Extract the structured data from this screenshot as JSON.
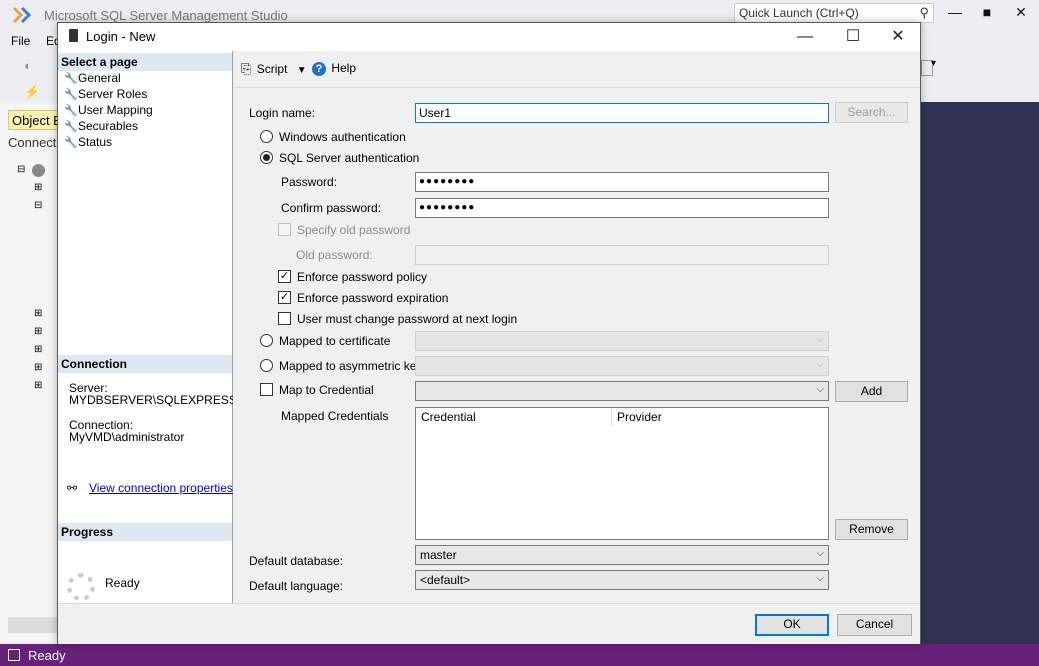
{
  "app": {
    "title": "Microsoft SQL Server Management Studio",
    "quick_launch_placeholder": "Quick Launch (Ctrl+Q)",
    "menu": [
      "File",
      "Ed"
    ],
    "object_explorer_tab": "Object E",
    "object_explorer_connect": "Connect",
    "status": "Ready"
  },
  "dialog": {
    "title": "Login - New",
    "toolbar": {
      "script": "Script",
      "help": "Help"
    },
    "left": {
      "select_page_header": "Select a page",
      "pages": [
        "General",
        "Server Roles",
        "User Mapping",
        "Securables",
        "Status"
      ],
      "connection_header": "Connection",
      "server_label": "Server:",
      "server_value": "MYDBSERVER\\SQLEXPRESS",
      "connection_label": "Connection:",
      "connection_value": "MyVMD\\administrator",
      "view_connection_link": "View connection properties",
      "progress_header": "Progress",
      "progress_status": "Ready"
    },
    "form": {
      "login_name_label": "Login name:",
      "login_name_value": "User1",
      "search_button": "Search...",
      "windows_auth": "Windows authentication",
      "sql_auth": "SQL Server authentication",
      "auth_selected": "sql",
      "password_label": "Password:",
      "password_value": "●●●●●●●●",
      "confirm_password_label": "Confirm password:",
      "confirm_password_value": "●●●●●●●●",
      "specify_old_password": "Specify old password",
      "old_password_label": "Old password:",
      "enforce_policy": "Enforce password policy",
      "enforce_policy_checked": true,
      "enforce_expiration": "Enforce password expiration",
      "enforce_expiration_checked": true,
      "must_change": "User must change password at next login",
      "must_change_checked": false,
      "mapped_certificate": "Mapped to certificate",
      "mapped_asymmetric_key": "Mapped to asymmetric key",
      "map_to_credential": "Map to Credential",
      "add_button": "Add",
      "mapped_credentials_label": "Mapped Credentials",
      "grid_columns": [
        "Credential",
        "Provider"
      ],
      "remove_button": "Remove",
      "default_database_label": "Default database:",
      "default_database_value": "master",
      "default_language_label": "Default language:",
      "default_language_value": "<default>"
    },
    "footer": {
      "ok": "OK",
      "cancel": "Cancel"
    }
  }
}
